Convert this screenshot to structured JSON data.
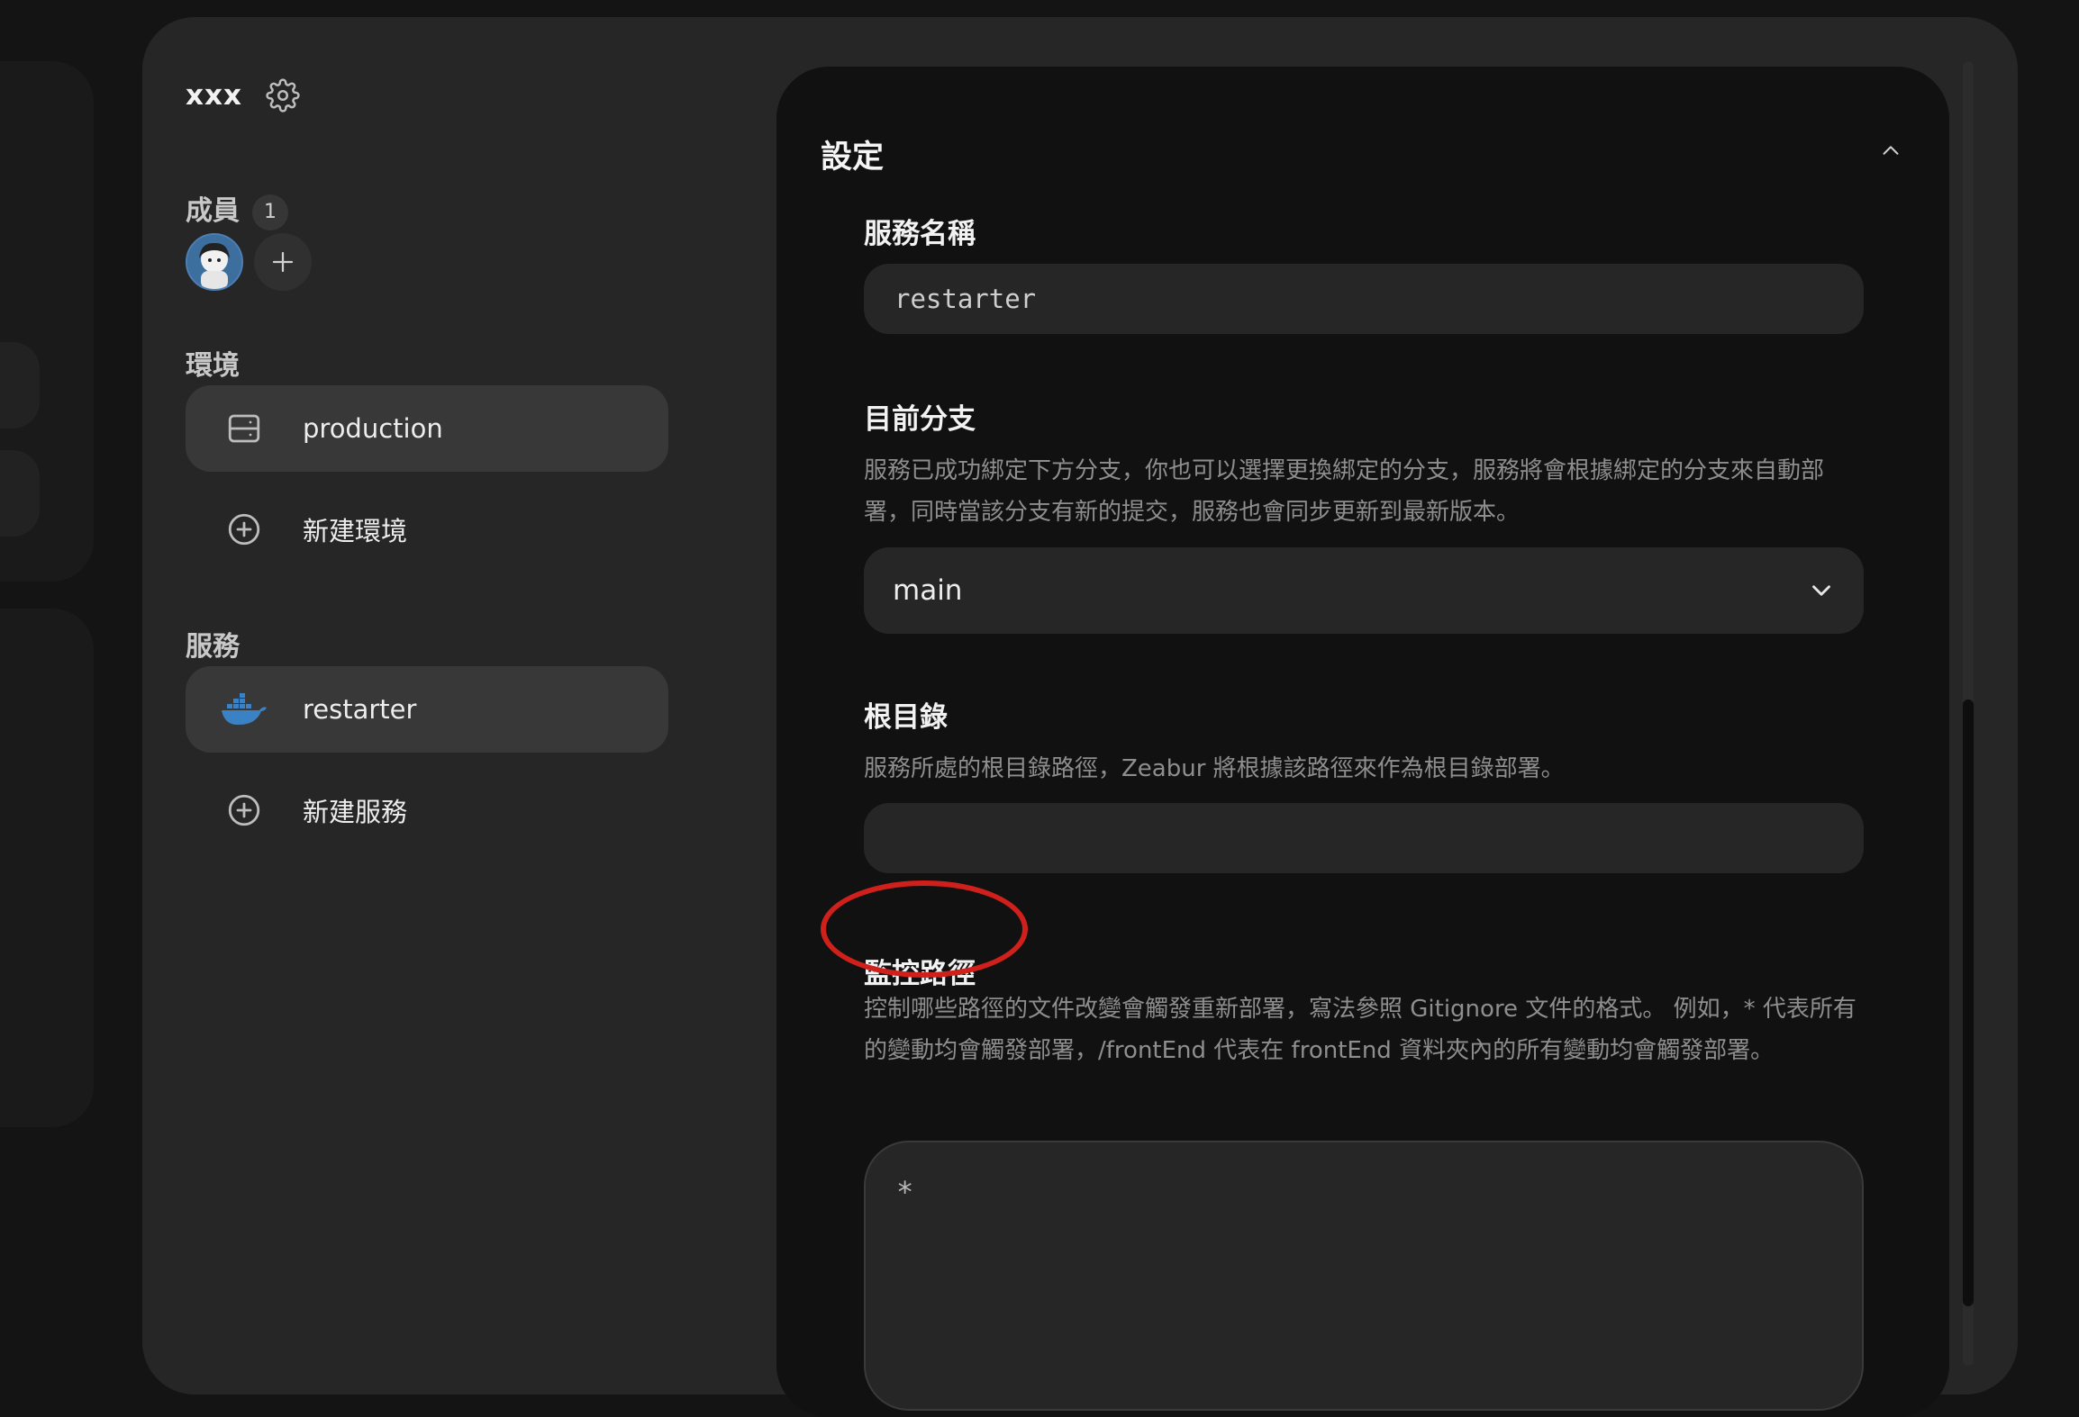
{
  "sidebar": {
    "project_name": "xxx",
    "members": {
      "title": "成員",
      "count": "1"
    },
    "environments": {
      "title": "環境",
      "items": [
        {
          "label": "production",
          "icon": "server-icon",
          "selected": true
        },
        {
          "label": "新建環境",
          "icon": "plus-circle-icon",
          "selected": false
        }
      ]
    },
    "services": {
      "title": "服務",
      "items": [
        {
          "label": "restarter",
          "icon": "docker-icon",
          "selected": true
        },
        {
          "label": "新建服務",
          "icon": "plus-circle-icon",
          "selected": false
        }
      ]
    }
  },
  "settings": {
    "title": "設定",
    "service_name": {
      "label": "服務名稱",
      "value": "restarter"
    },
    "branch": {
      "label": "目前分支",
      "description": "服務已成功綁定下方分支，你也可以選擇更換綁定的分支，服務將會根據綁定的分支來自動部署，同時當該分支有新的提交，服務也會同步更新到最新版本。",
      "value": "main"
    },
    "root_dir": {
      "label": "根目錄",
      "description": "服務所處的根目錄路徑，Zeabur 將根據該路徑來作為根目錄部署。",
      "value": ""
    },
    "watch_paths": {
      "label": "監控路徑",
      "description": "控制哪些路徑的文件改變會觸發重新部署，寫法參照 Gitignore 文件的格式。 例如，* 代表所有的變動均會觸發部署，/frontEnd 代表在 frontEnd 資料夾內的所有變動均會觸發部署。",
      "value": "*"
    }
  },
  "colors": {
    "background": "#141414",
    "panel": "#262626",
    "card": "#111111",
    "annotation": "#d0201b",
    "docker": "#3b82c4"
  }
}
